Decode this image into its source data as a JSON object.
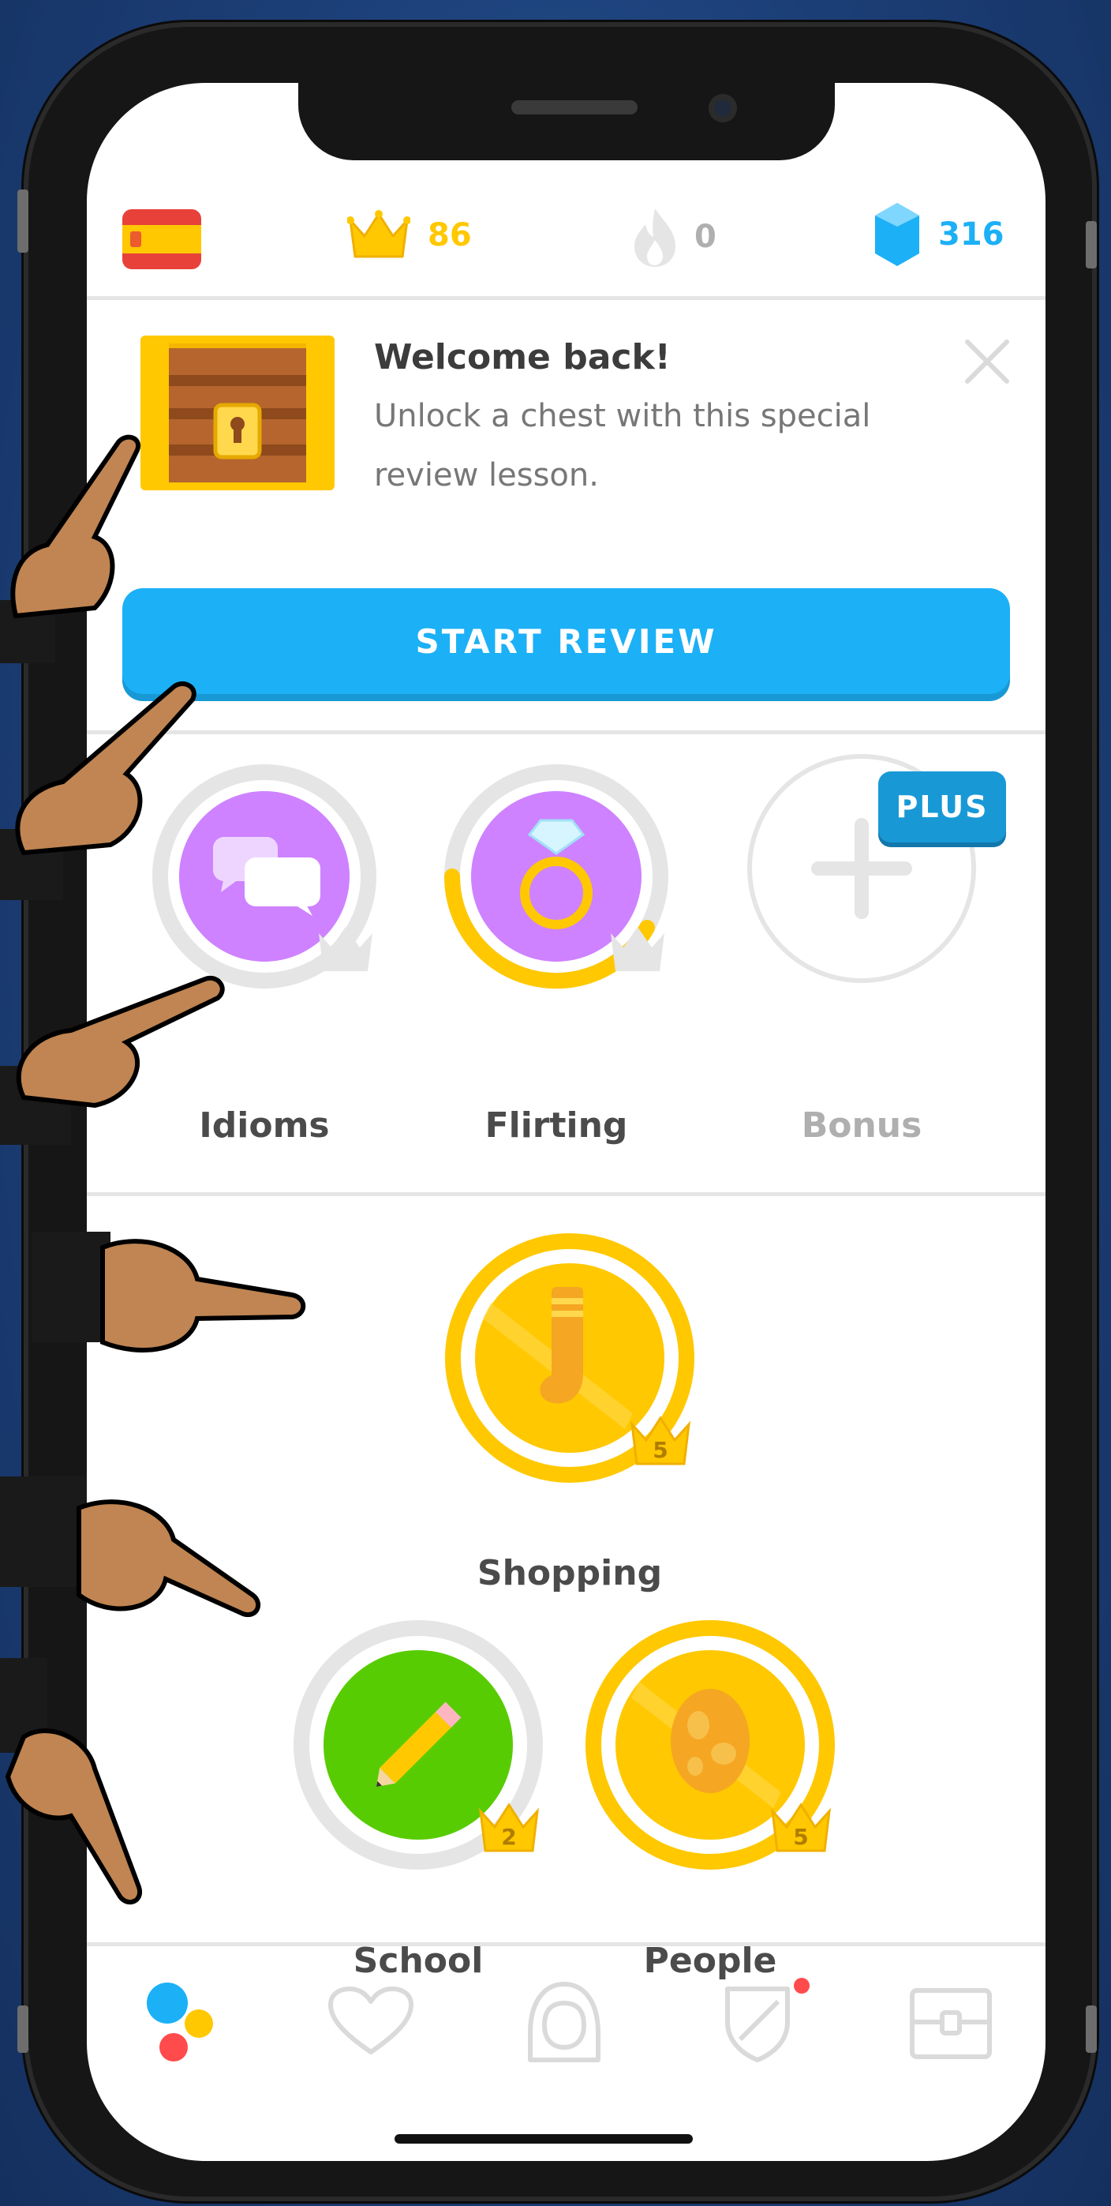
{
  "status_bar": {
    "flag": "spanish-flag-icon",
    "crowns": "86",
    "streak": "0",
    "gems": "316"
  },
  "welcome": {
    "title": "Welcome back!",
    "line1": "Unlock a chest with this special",
    "line2": "review lesson.",
    "button": "START REVIEW"
  },
  "bonus_skills": [
    {
      "label": "Idioms",
      "icon": "speech-bubbles-icon"
    },
    {
      "label": "Flirting",
      "icon": "ring-icon"
    },
    {
      "label": "Bonus",
      "icon": "plus-icon",
      "badge": "PLUS"
    }
  ],
  "skills": [
    {
      "label": "Shopping",
      "icon": "sock-icon",
      "level": "5"
    },
    {
      "label": "School",
      "icon": "pencil-icon",
      "level": "2"
    },
    {
      "label": "People",
      "icon": "egg-icon",
      "level": "5"
    }
  ],
  "tabbar": [
    "learn-tab-icon",
    "heart-tab-icon",
    "profile-tab-icon",
    "league-tab-icon",
    "shop-tab-icon"
  ],
  "colors": {
    "blue": "#1cb0f6",
    "gold": "#ffc800",
    "purple": "#ce82ff",
    "green": "#58cc02",
    "gray": "#e5e5e5"
  }
}
